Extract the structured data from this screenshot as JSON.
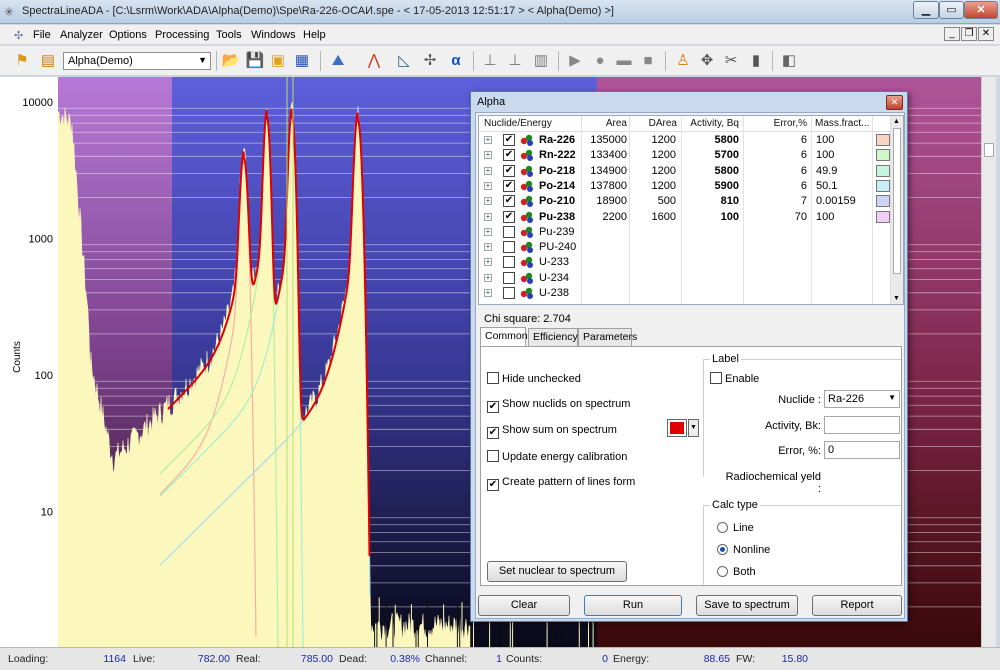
{
  "window": {
    "title": "SpectraLineADA - [C:\\Lsrm\\Work\\ADA\\Alpha(Demo)\\Spe\\Ra-226-ОСАИ.spe - < 17-05-2013 12:51:17 > < Alpha(Demo) >]"
  },
  "menu": [
    "File",
    "Analyzer",
    "Options",
    "Processing",
    "Tools",
    "Windows",
    "Help"
  ],
  "toolbar": {
    "detector": "Alpha(Demo)"
  },
  "spectrum": {
    "ylabel": "Counts",
    "yticks": [
      "10000",
      "1000",
      "100",
      "10"
    ]
  },
  "dialog": {
    "title": "Alpha",
    "columns": [
      "Nuclide/Energy",
      "Area",
      "DArea",
      "Activity, Bq",
      "Error,%",
      "Mass.fract..."
    ],
    "rows": [
      {
        "name": "Ra-226",
        "checked": "✔",
        "area": "135000",
        "darea": "1200",
        "activity": "5800",
        "error": "6",
        "mass": "100",
        "color": "#f9d3c3"
      },
      {
        "name": "Rn-222",
        "checked": "✔",
        "area": "133400",
        "darea": "1200",
        "activity": "5700",
        "error": "6",
        "mass": "100",
        "color": "#d0f7c8"
      },
      {
        "name": "Po-218",
        "checked": "✔",
        "area": "134900",
        "darea": "1200",
        "activity": "5800",
        "error": "6",
        "mass": "49.9",
        "color": "#c6f4df"
      },
      {
        "name": "Po-214",
        "checked": "✔",
        "area": "137800",
        "darea": "1200",
        "activity": "5900",
        "error": "6",
        "mass": "50.1",
        "color": "#c8eef8"
      },
      {
        "name": "Po-210",
        "checked": "✔",
        "area": "18900",
        "darea": "500",
        "activity": "810",
        "error": "7",
        "mass": "0.00159",
        "color": "#cfd3f8"
      },
      {
        "name": "Pu-238",
        "checked": "✔",
        "area": "2200",
        "darea": "1600",
        "activity": "100",
        "error": "70",
        "mass": "100",
        "color": "#f1ccf5"
      },
      {
        "name": "Pu-239",
        "checked": "",
        "area": "",
        "darea": "",
        "activity": "",
        "error": "",
        "mass": "",
        "color": ""
      },
      {
        "name": "PU-240",
        "checked": "",
        "area": "",
        "darea": "",
        "activity": "",
        "error": "",
        "mass": "",
        "color": ""
      },
      {
        "name": "U-233",
        "checked": "",
        "area": "",
        "darea": "",
        "activity": "",
        "error": "",
        "mass": "",
        "color": ""
      },
      {
        "name": "U-234",
        "checked": "",
        "area": "",
        "darea": "",
        "activity": "",
        "error": "",
        "mass": "",
        "color": ""
      },
      {
        "name": "U-238",
        "checked": "",
        "area": "",
        "darea": "",
        "activity": "",
        "error": "",
        "mass": "",
        "color": ""
      }
    ],
    "chi_square": "Chi square: 2.704",
    "tabs": [
      "Common",
      "Efficiency",
      "Parameters"
    ],
    "options": {
      "hide_unchecked": "Hide unchecked",
      "show_nuclides": "Show nuclids on spectrum",
      "show_sum": "Show sum on spectrum",
      "update_energy": "Update energy calibration",
      "create_pattern": "Create pattern of lines form"
    },
    "label_group": {
      "title": "Label",
      "enable": "Enable",
      "nuclide_label": "Nuclide :",
      "nuclide_value": "Ra-226",
      "activity_label": "Activity, Bk:",
      "activity_value": "",
      "error_label": "Error, %:",
      "error_value": "0",
      "radiochem_label": "Radiochemical yeld :"
    },
    "calc_group": {
      "title": "Calc type",
      "line": "Line",
      "nonline": "Nonline",
      "both": "Both"
    },
    "set_nuclear_button": "Set nuclear to spectrum",
    "buttons": {
      "clear": "Clear",
      "run": "Run",
      "save": "Save to spectrum",
      "report": "Report"
    },
    "sum_color": "#e00000"
  },
  "status": {
    "loading_label": "Loading:",
    "loading": "1164",
    "live_label": "Live:",
    "live": "782.00",
    "real_label": "Real:",
    "real": "785.00",
    "dead_label": "Dead:",
    "dead": "0.38%",
    "channel_label": "Channel:",
    "channel": "1",
    "counts_label": "Counts:",
    "counts": "0",
    "energy_label": "Energy:",
    "energy": "88.65",
    "fw_label": "FW:",
    "fw": "15.80"
  }
}
